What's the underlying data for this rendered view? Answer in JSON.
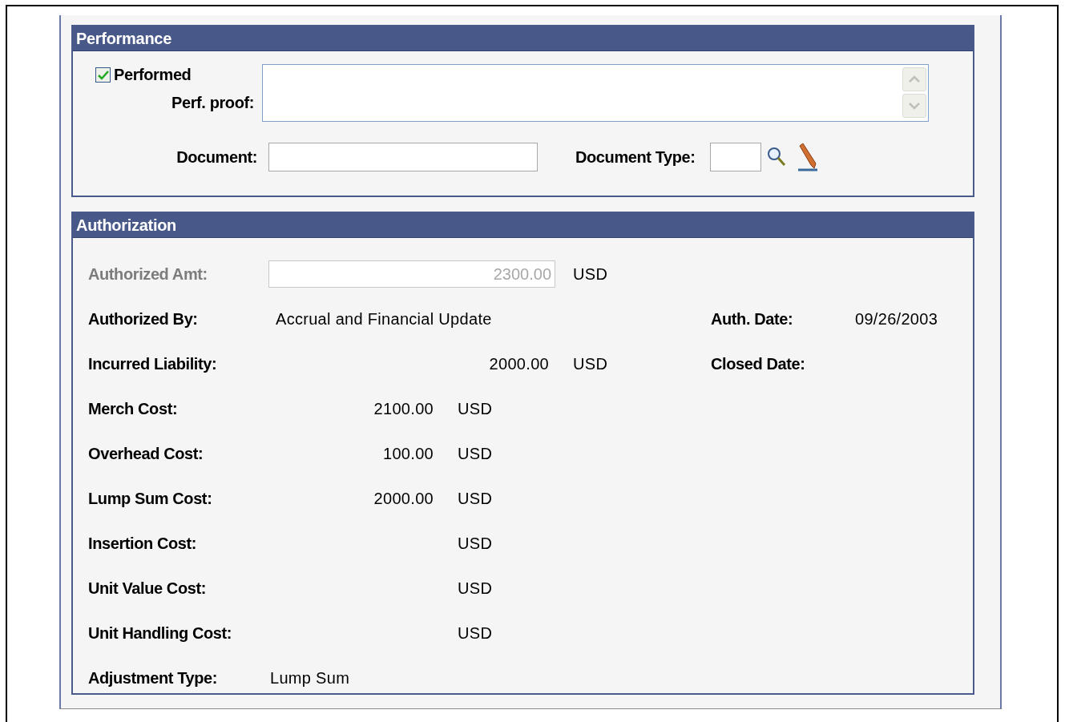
{
  "performance": {
    "title": "Performance",
    "performed": {
      "label": "Performed",
      "checked": true
    },
    "perf_proof": {
      "label": "Perf. proof:"
    },
    "document": {
      "label": "Document:"
    },
    "document_type": {
      "label": "Document Type:"
    }
  },
  "authorization": {
    "title": "Authorization",
    "rows": [
      {
        "kind": "input",
        "label": "Authorized Amt:",
        "disabled": true,
        "value": "2300.00",
        "currency": "USD"
      },
      {
        "kind": "text",
        "label": "Authorized By:",
        "value": "Accrual and Financial Update",
        "side": {
          "label": "Auth. Date:",
          "value": "09/26/2003"
        }
      },
      {
        "kind": "wide_amount",
        "label": "Incurred Liability:",
        "value": "2000.00",
        "currency": "USD",
        "side": {
          "label": "Closed Date:"
        }
      },
      {
        "kind": "amount",
        "label": "Merch Cost:",
        "value": "2100.00",
        "currency": "USD"
      },
      {
        "kind": "amount",
        "label": "Overhead Cost:",
        "value": "100.00",
        "currency": "USD"
      },
      {
        "kind": "amount",
        "label": "Lump Sum Cost:",
        "value": "2000.00",
        "currency": "USD"
      },
      {
        "kind": "amount",
        "label": "Insertion Cost:",
        "currency": "USD"
      },
      {
        "kind": "amount",
        "label": "Unit Value Cost:",
        "currency": "USD"
      },
      {
        "kind": "amount",
        "label": "Unit Handling Cost:",
        "currency": "USD"
      },
      {
        "kind": "label_text",
        "label": "Adjustment Type:",
        "value": "Lump Sum"
      }
    ]
  }
}
